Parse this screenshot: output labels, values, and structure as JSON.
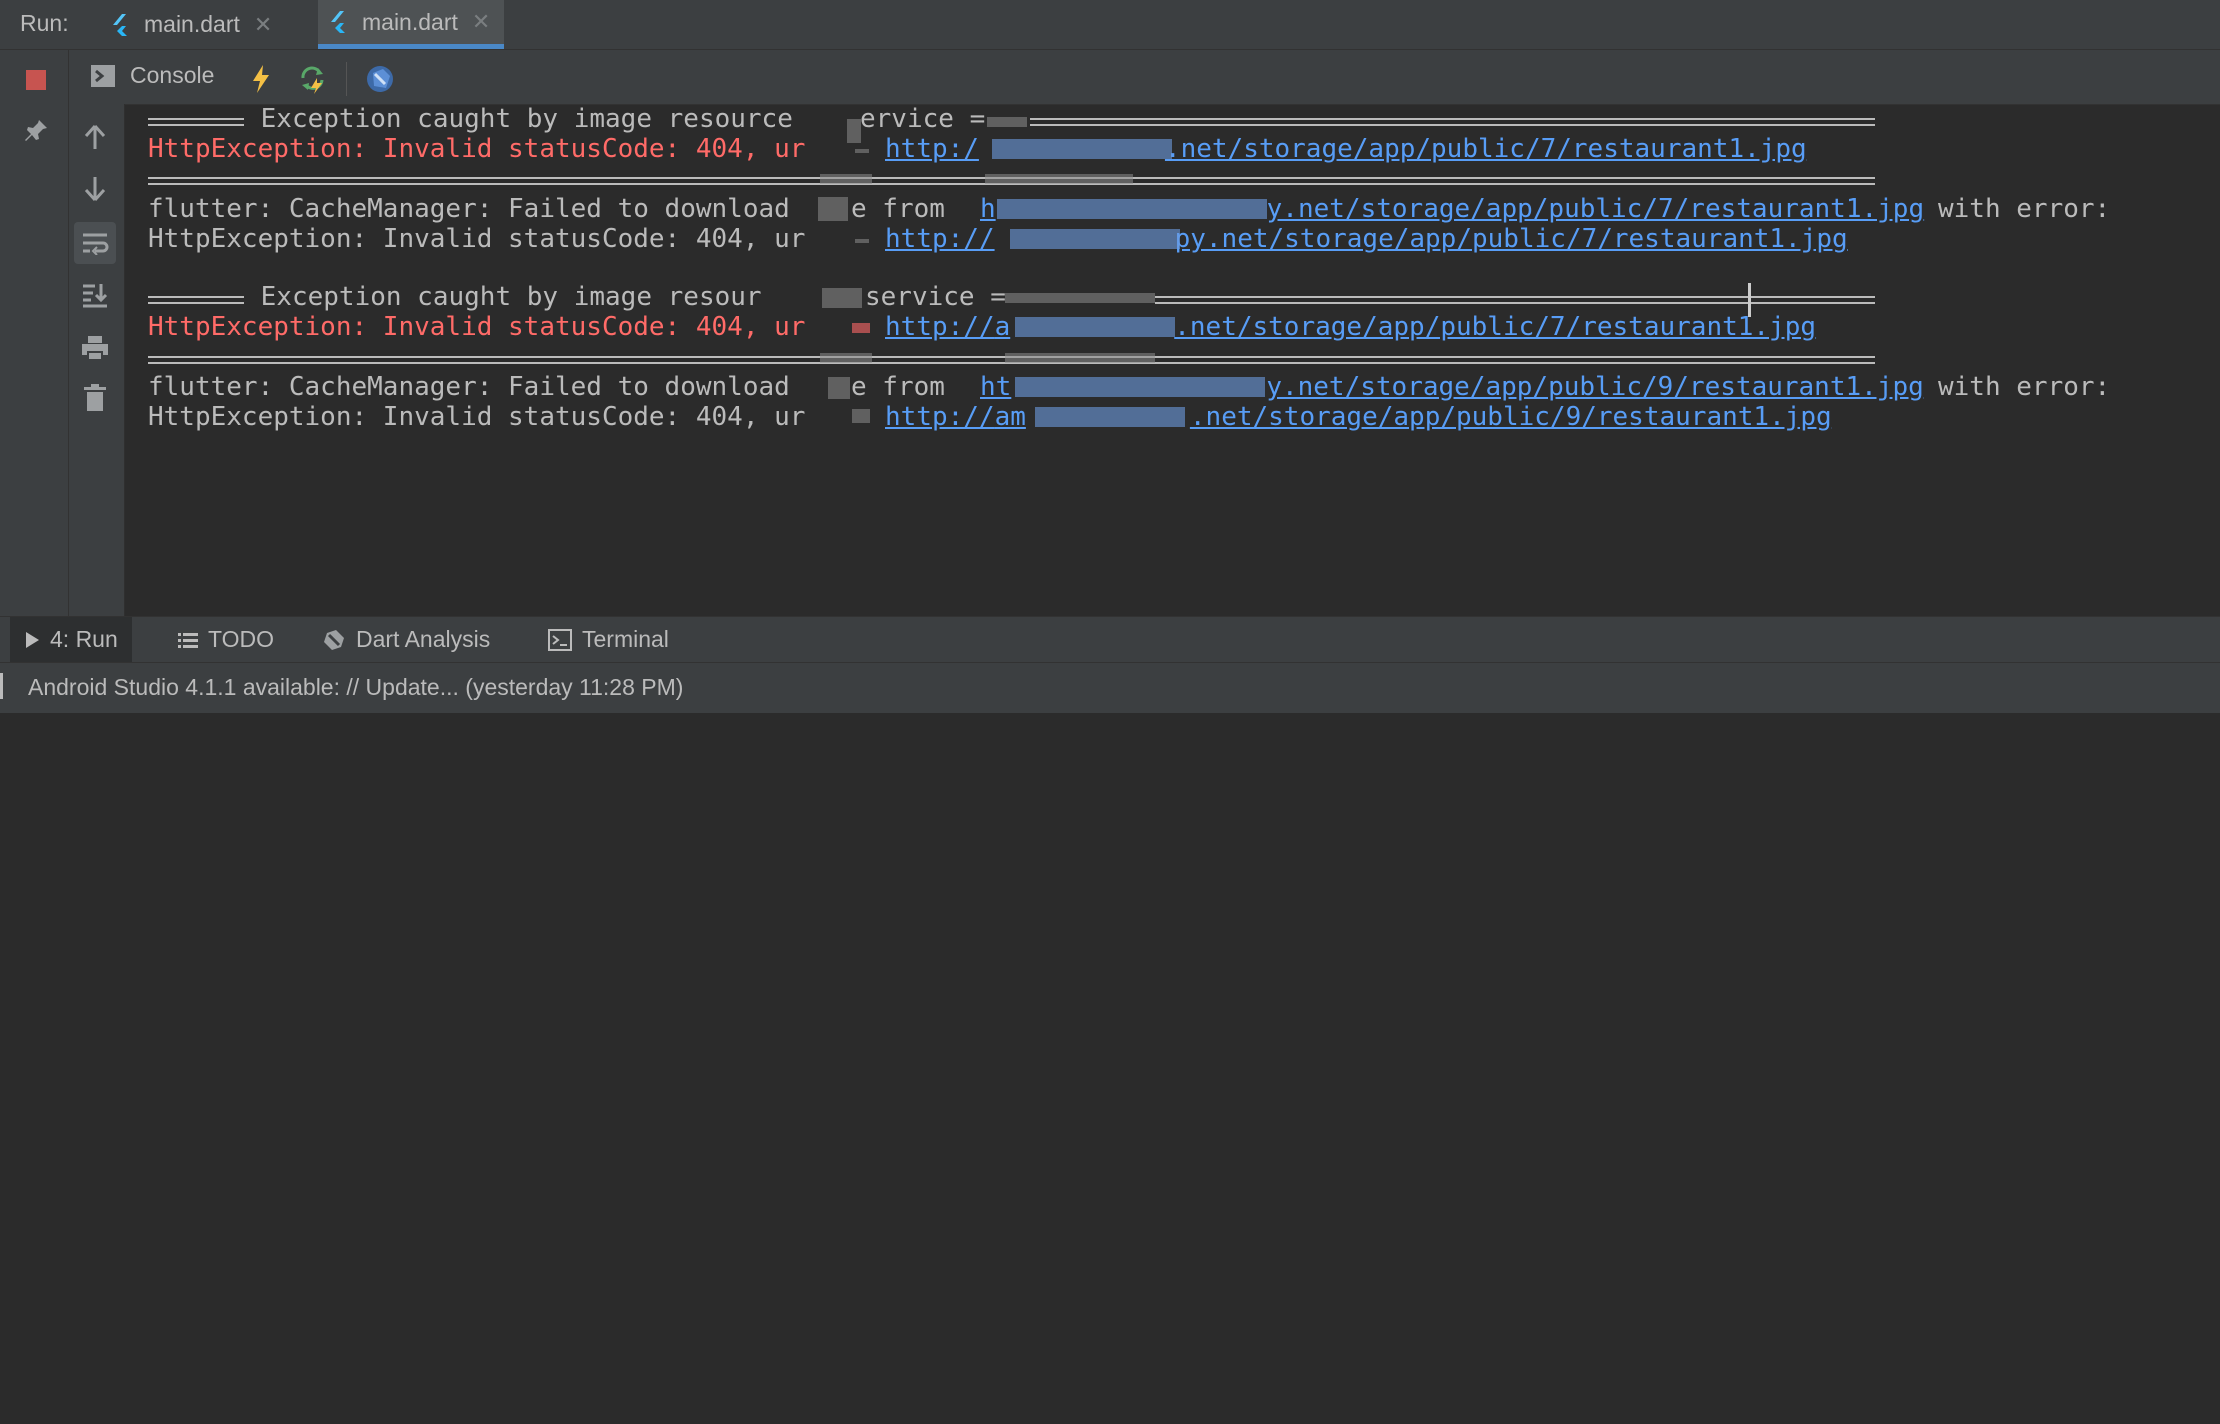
{
  "run_bar": {
    "label": "Run:",
    "tabs": [
      {
        "label": "main.dart",
        "active": false
      },
      {
        "label": "main.dart",
        "active": true
      }
    ]
  },
  "toolbar": {
    "console_label": "Console",
    "icons": [
      "stop-icon",
      "console-icon",
      "hot-reload-icon",
      "hot-restart-icon",
      "dart-devtools-icon"
    ]
  },
  "gutter_icons": [
    "pin-icon",
    "up-arrow-icon",
    "down-arrow-icon",
    "soft-wrap-icon",
    "scroll-to-end-icon",
    "print-icon",
    "trash-icon"
  ],
  "console": {
    "header_text": "Exception caught by image resource service",
    "header_line_1": " Exception caught by image resource",
    "header_line_1_b": "ervice =",
    "header_line_2": " Exception caught by image resour",
    "header_line_2_b": "service =",
    "http_prefix": "HttpException: Invalid statusCode: 404, ur",
    "cache_prefix": "flutter: CacheManager: Failed to download",
    "cache_mid": "e from",
    "cache_suffix": "with error:",
    "url_a": ".net/storage/app/public/7/restaurant1.jpg",
    "url_b": ".net/storage/app/public/9/restaurant1.jpg",
    "link_start_http": "http:/",
    "link_start_http2": "http://",
    "link_start_h": "h",
    "link_start_ht": "ht",
    "link_end_y": "y.net/storage/app/public/7/restaurant1.jpg",
    "link_end_y9": "y.net/storage/app/public/9/restaurant1.jpg",
    "link_end_py": "py.net/storage/app/public/7/restaurant1.jpg",
    "link_end_a": "a",
    "link_end_am": "am"
  },
  "bottom_tabs": [
    {
      "label": "4: Run",
      "icon": "play-icon",
      "active": true
    },
    {
      "label": "TODO",
      "icon": "list-icon",
      "active": false
    },
    {
      "label": "Dart Analysis",
      "icon": "dart-icon",
      "active": false
    },
    {
      "label": "Terminal",
      "icon": "terminal-icon",
      "active": false
    }
  ],
  "status_bar": {
    "message": "Android Studio 4.1.1 available: // Update... (yesterday 11:28 PM)"
  },
  "colors": {
    "background": "#2b2b2b",
    "panel": "#3c3f41",
    "error_red": "#ff6b68",
    "link_blue": "#589df6",
    "tab_accent": "#4a88c7"
  }
}
